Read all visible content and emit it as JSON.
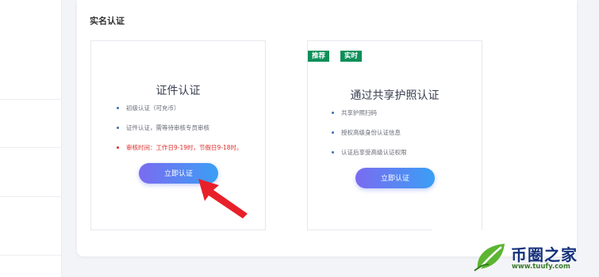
{
  "section": {
    "title": "实名认证"
  },
  "cards": [
    {
      "title": "证件认证",
      "bullets": [
        "初级认证（可充币）",
        "证件认证，需等待审核专员审核",
        "审核时间：工作日9-19时，节假日9-18时。"
      ],
      "button": "立即认证"
    },
    {
      "title": "通过共享护照认证",
      "tags": [
        "推荐",
        "实时"
      ],
      "bullets": [
        "共享护照扫码",
        "授权高级身份认证信息",
        "认证后享受高级认证权限"
      ],
      "button": "立即认证"
    }
  ],
  "watermark": {
    "brand": "币圈之家",
    "url": "www.tuufy.com"
  },
  "colors": {
    "accent_start": "#7a6bf0",
    "accent_end": "#3a9ff5",
    "tag_green": "#0e8f5a",
    "warning_red": "#e02b2b",
    "arrow_red": "#e8202a"
  }
}
